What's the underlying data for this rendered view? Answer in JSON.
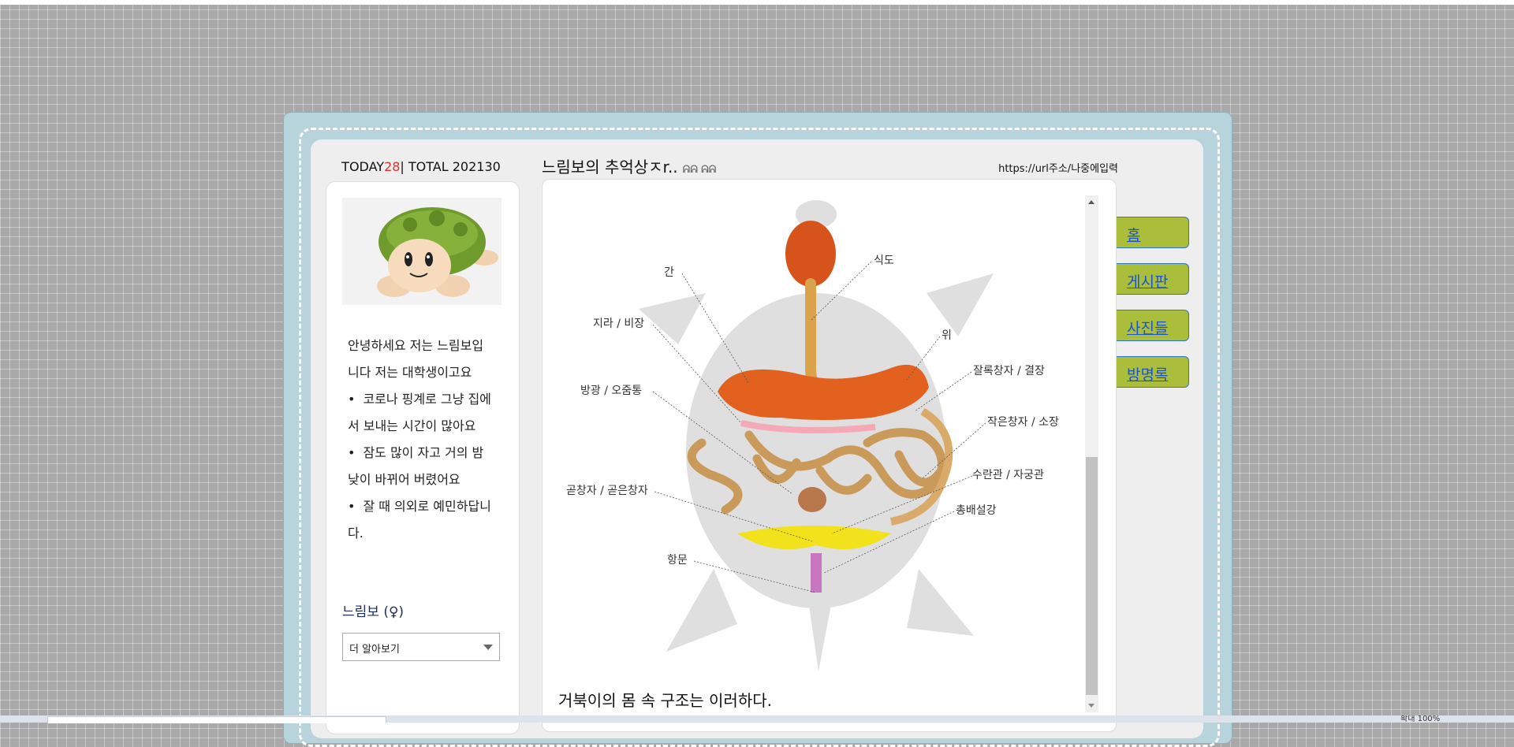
{
  "counter": {
    "today_label": "TODAY",
    "today_value": "28",
    "total": "| TOTAL 202130"
  },
  "profile": {
    "intro_lines": [
      "안녕하세요 저는 느림보입니다 저는 대학생이고요"
    ],
    "bullets": [
      "코로나 핑계로 그냥 집에서 보내는 시간이 많아요",
      "잠도 많이 자고 거의 밤낮이 바뀌어 버렸어요",
      "잘 때 의외로 예민하답니다."
    ],
    "bullet_char": "•",
    "name": "느림보 (♀)",
    "more_select": "더 알아보기"
  },
  "blog": {
    "title": "느림보의 추억상ㅈr..",
    "title_deco": "ᕱᕱ ᕱᕱ",
    "url": "https://url주소/나중에입력"
  },
  "diagram": {
    "labels": {
      "esophagus": "식도",
      "liver": "간",
      "stomach": "위",
      "spleen": "지라 / 비장",
      "large_intestine": "잘록창자 / 결장",
      "bladder": "방광 / 오줌통",
      "small_intestine": "작은창자 / 소장",
      "oviduct": "수란관 / 자궁관",
      "rectum": "곧창자 / 곧은창자",
      "cloaca": "총배설강",
      "anus": "항문"
    }
  },
  "caption": "거북이의 몸 속 구조는 이러하다.",
  "nav": [
    "홈",
    "게시판",
    "사진들",
    "방명록"
  ],
  "bottom": {
    "zoom": "확대 100%"
  },
  "colors": {
    "page_bg": "#a9a9a9",
    "frame": "#b7d3dc",
    "nav_button": "#aabe3c",
    "nav_link": "#1a53d1",
    "today_count": "#e0302a"
  }
}
